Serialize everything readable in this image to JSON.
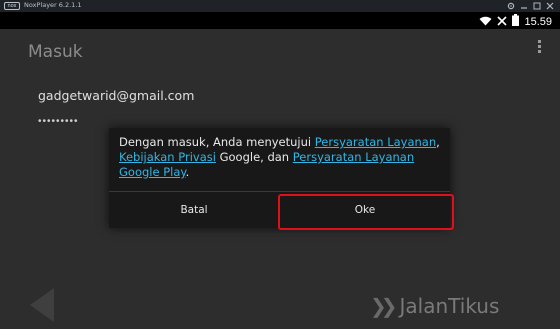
{
  "window": {
    "logo_text": "nox",
    "title": "NoxPlayer 6.2.1.1",
    "buttons": [
      "settings-icon",
      "minimize-icon",
      "maximize-icon",
      "close-icon"
    ]
  },
  "statusbar": {
    "icons": [
      "wifi-icon",
      "no-sim-icon",
      "battery-icon"
    ],
    "time": "15.59"
  },
  "page": {
    "title": "Masuk",
    "email": "gadgetwarid@gmail.com",
    "password_mask": "•••••••••"
  },
  "dialog": {
    "message_start": "Dengan masuk, Anda menyetujui ",
    "link_terms": "Persyaratan Layanan",
    "sep1": ", ",
    "link_privacy": "Kebijakan Privasi",
    "mid": " Google, dan ",
    "link_play_terms": "Persyaratan Layanan Google Play",
    "end": ".",
    "cancel_label": "Batal",
    "ok_label": "Oke"
  },
  "watermark": {
    "text": "JalanTikus"
  },
  "colors": {
    "link": "#33b5e5",
    "highlight": "#e0101b"
  }
}
